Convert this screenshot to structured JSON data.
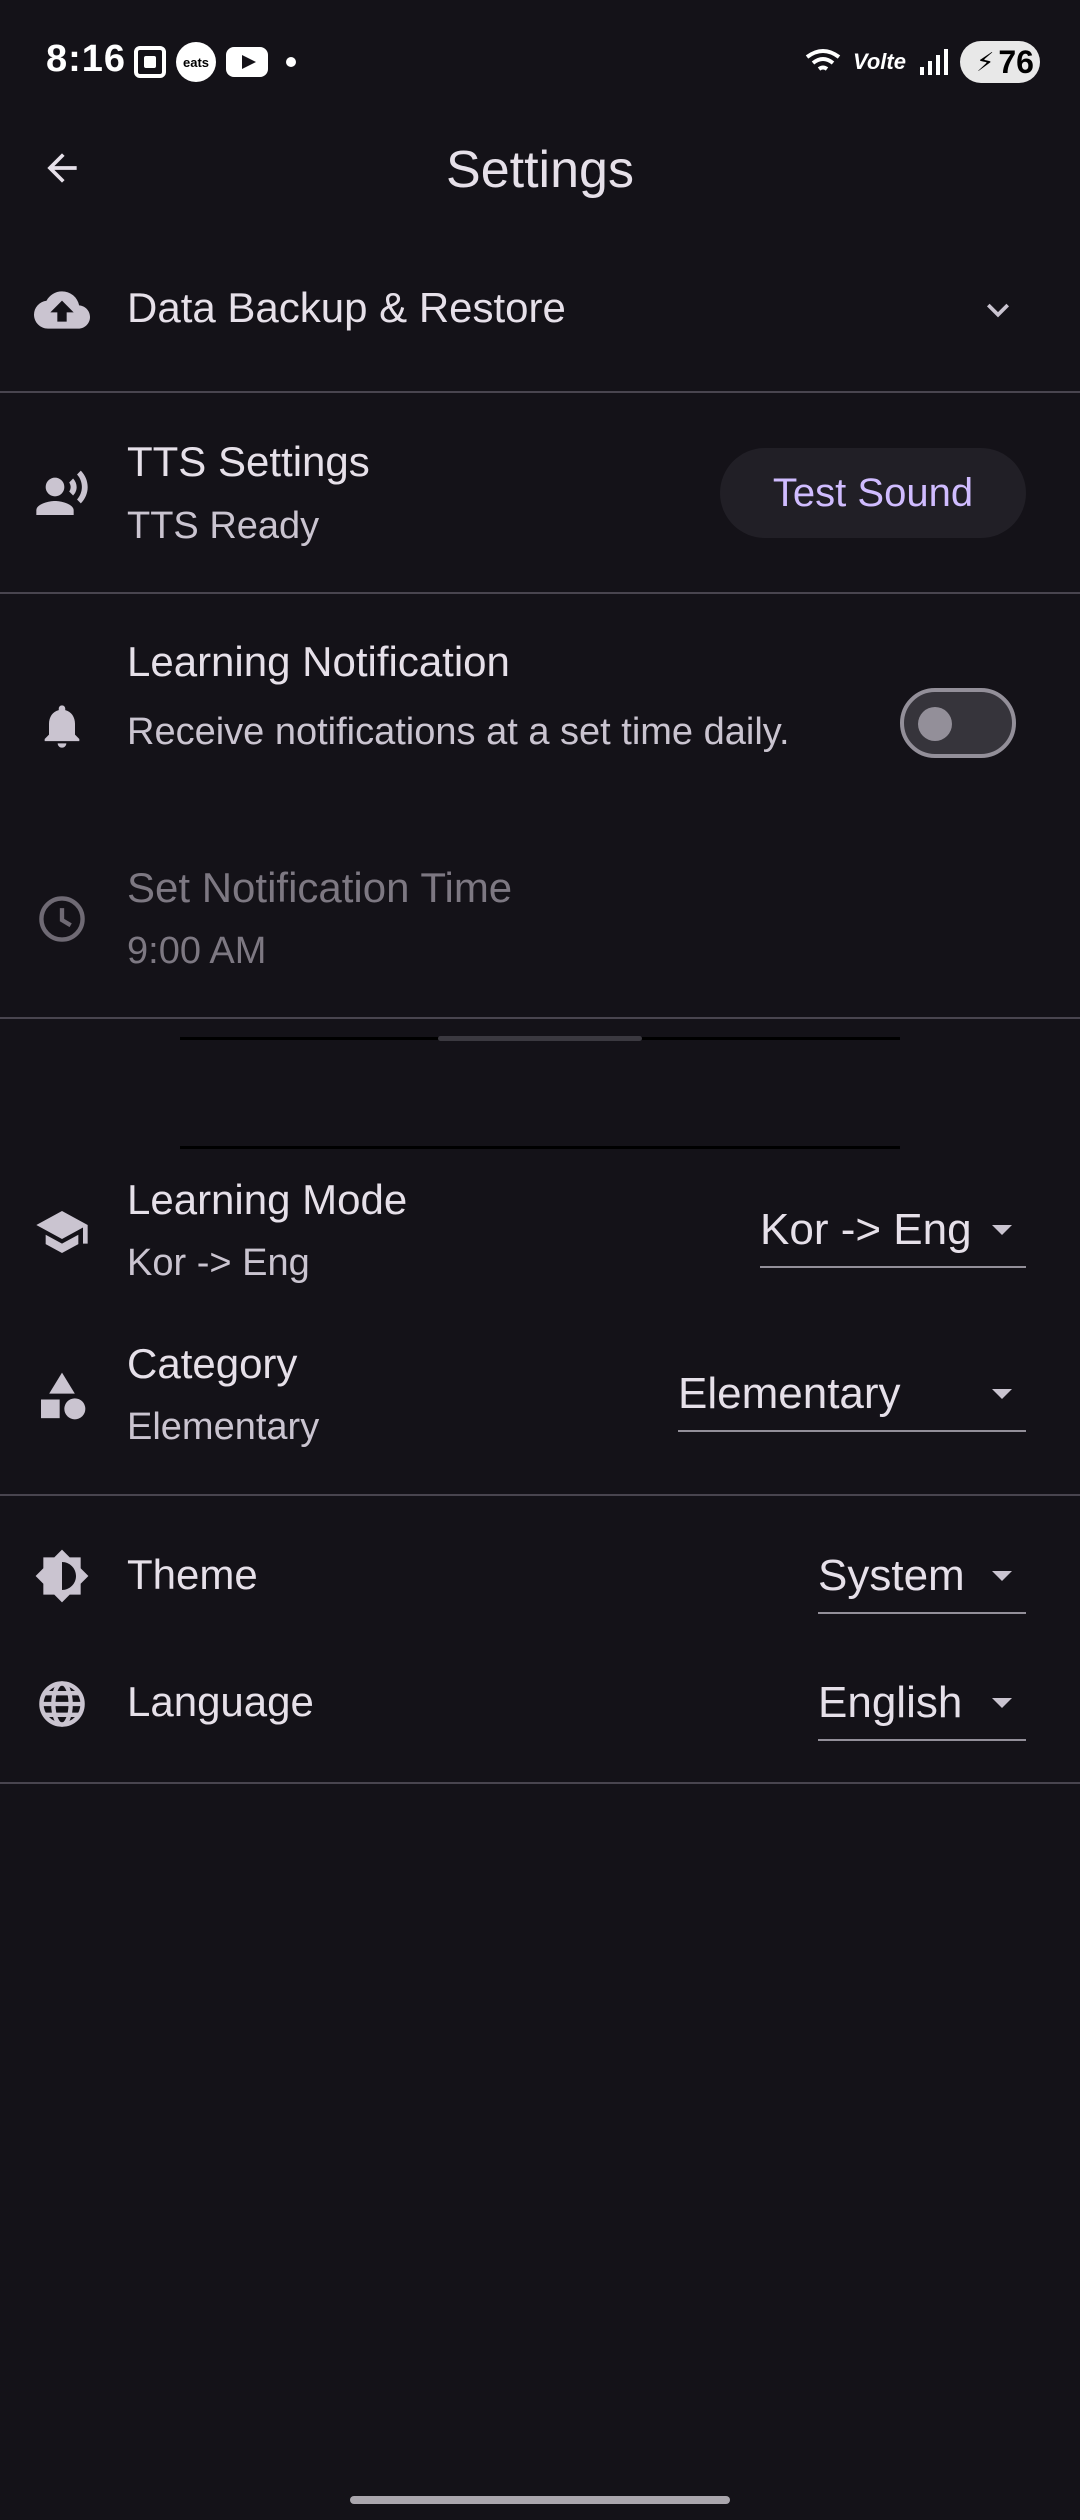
{
  "status_bar": {
    "time": "8:16",
    "eats_label": "eats",
    "network": "Volte",
    "battery": "76"
  },
  "header": {
    "title": "Settings"
  },
  "backup": {
    "title": "Data Backup & Restore"
  },
  "tts": {
    "title": "TTS Settings",
    "status": "TTS Ready",
    "test_button": "Test Sound"
  },
  "notification": {
    "title": "Learning Notification",
    "description": "Receive notifications at a set time daily.",
    "enabled": false,
    "time_title": "Set Notification Time",
    "time_value": "9:00 AM"
  },
  "learning_mode": {
    "title": "Learning Mode",
    "value": "Kor -> Eng",
    "selected": "Kor -> Eng"
  },
  "category": {
    "title": "Category",
    "value": "Elementary",
    "selected": "Elementary"
  },
  "theme": {
    "title": "Theme",
    "selected": "System"
  },
  "language": {
    "title": "Language",
    "selected": "English"
  },
  "colors": {
    "background": "#141218",
    "accent": "#d0bcff",
    "text": "#e6e0e9",
    "divider": "#49454f"
  },
  "icons": {
    "back": "arrow-back-icon",
    "backup": "cloud-upload-icon",
    "expand": "chevron-down-icon",
    "tts": "record-voice-icon",
    "notification": "bell-icon",
    "time": "clock-icon",
    "mode": "school-icon",
    "category": "category-shapes-icon",
    "theme": "brightness-icon",
    "language": "globe-icon"
  }
}
